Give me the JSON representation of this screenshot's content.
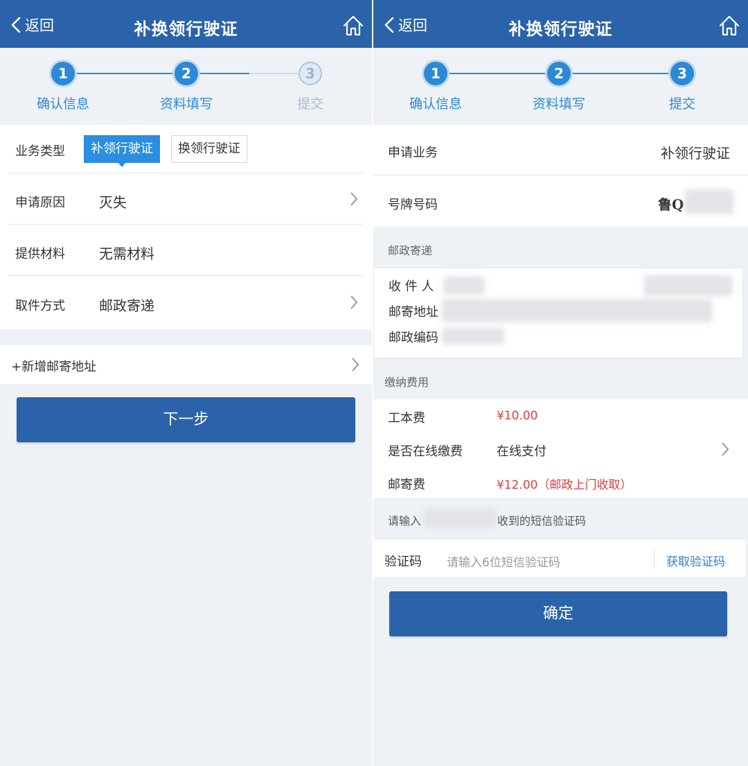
{
  "left": {
    "nav": {
      "back_label": "返回",
      "title": "补换领行驶证"
    },
    "steps": [
      {
        "num": "1",
        "label": "确认信息"
      },
      {
        "num": "2",
        "label": "资料填写"
      },
      {
        "num": "3",
        "label": "提交"
      }
    ],
    "business_type": {
      "label": "业务类型",
      "options": [
        "补领行驶证",
        "换领行驶证"
      ],
      "selected": "补领行驶证"
    },
    "rows": [
      {
        "label": "申请原因",
        "value": "灭失"
      },
      {
        "label": "提供材料",
        "value": "无需材料"
      },
      {
        "label": "取件方式",
        "value": "邮政寄递"
      }
    ],
    "add_address": "+新增邮寄地址",
    "next_button": "下一步"
  },
  "right": {
    "nav": {
      "back_label": "返回",
      "title": "补换领行驶证"
    },
    "steps": [
      {
        "num": "1",
        "label": "确认信息"
      },
      {
        "num": "2",
        "label": "资料填写"
      },
      {
        "num": "3",
        "label": "提交"
      }
    ],
    "apply_business": {
      "label": "申请业务",
      "value": "补领行驶证"
    },
    "plate": {
      "label": "号牌号码",
      "value": "鲁Q"
    },
    "postal_section": "邮政寄递",
    "recipient_label": "收 件 人",
    "address_label": "邮寄地址",
    "zip_label": "邮政编码",
    "fee_section": "缴纳费用",
    "fees": {
      "material_label": "工本费",
      "material_value": "¥10.00",
      "online_label": "是否在线缴费",
      "online_value": "在线支付",
      "postage_label": "邮寄费",
      "postage_value": "¥12.00（邮政上门收取）"
    },
    "sms_hint_prefix": "请输入",
    "sms_hint_suffix": "收到的短信验证码",
    "verify": {
      "label": "验证码",
      "placeholder": "请输入6位短信验证码",
      "get_code": "获取验证码"
    },
    "confirm_button": "确定"
  },
  "colors": {
    "nav_blue": "#2a63a9",
    "step_blue": "#2d89d6",
    "price_red": "#e03c3c",
    "link_blue": "#2f7fd0"
  }
}
